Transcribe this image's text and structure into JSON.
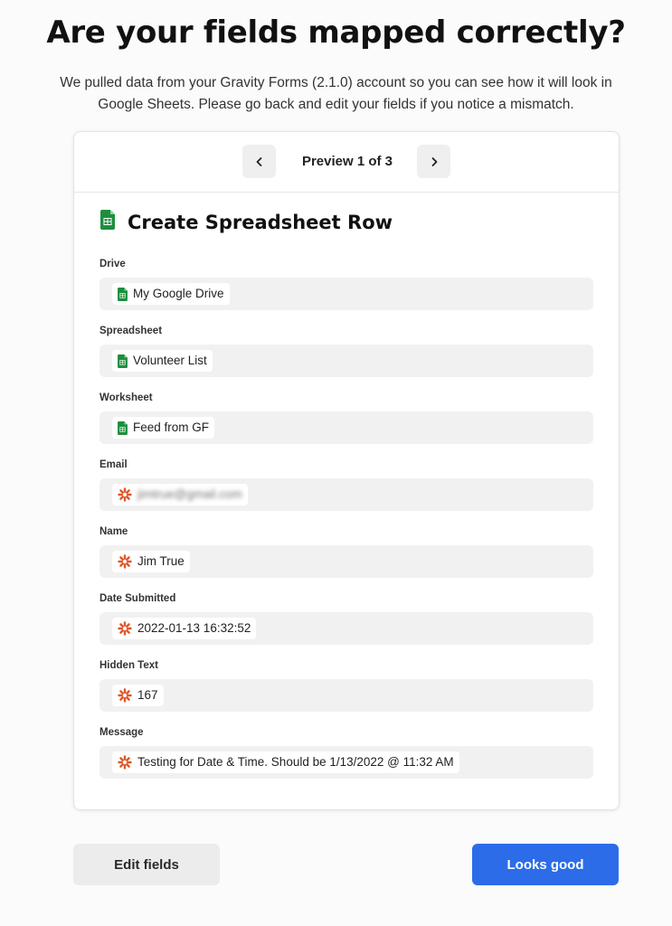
{
  "header": {
    "title": "Are your fields mapped correctly?",
    "subtitle": "We pulled data from your Gravity Forms (2.1.0) account so you can see how it will look in Google Sheets. Please go back and edit your fields if you notice a mismatch."
  },
  "preview": {
    "label": "Preview 1 of 3",
    "prev_icon": "chevron-left-icon",
    "next_icon": "chevron-right-icon"
  },
  "action": {
    "title": "Create Spreadsheet Row",
    "icon": "google-sheets-icon"
  },
  "fields": [
    {
      "label": "Drive",
      "value": "My Google Drive",
      "icon": "google-sheets-icon"
    },
    {
      "label": "Spreadsheet",
      "value": "Volunteer List",
      "icon": "google-sheets-icon"
    },
    {
      "label": "Worksheet",
      "value": "Feed from GF",
      "icon": "google-sheets-icon"
    },
    {
      "label": "Email",
      "value": "jimtrue@gmail.com",
      "icon": "gravity-forms-icon",
      "blurred": true
    },
    {
      "label": "Name",
      "value": "Jim True",
      "icon": "gravity-forms-icon"
    },
    {
      "label": "Date Submitted",
      "value": "2022-01-13 16:32:52",
      "icon": "gravity-forms-icon"
    },
    {
      "label": "Hidden Text",
      "value": "167",
      "icon": "gravity-forms-icon"
    },
    {
      "label": "Message",
      "value": "Testing for Date & Time. Should be 1/13/2022 @ 11:32 AM",
      "icon": "gravity-forms-icon"
    }
  ],
  "buttons": {
    "edit_label": "Edit fields",
    "confirm_label": "Looks good"
  },
  "colors": {
    "sheets_green": "#1e8e3e",
    "gravity_orange": "#e0572a",
    "primary_blue": "#2c6ce8"
  }
}
